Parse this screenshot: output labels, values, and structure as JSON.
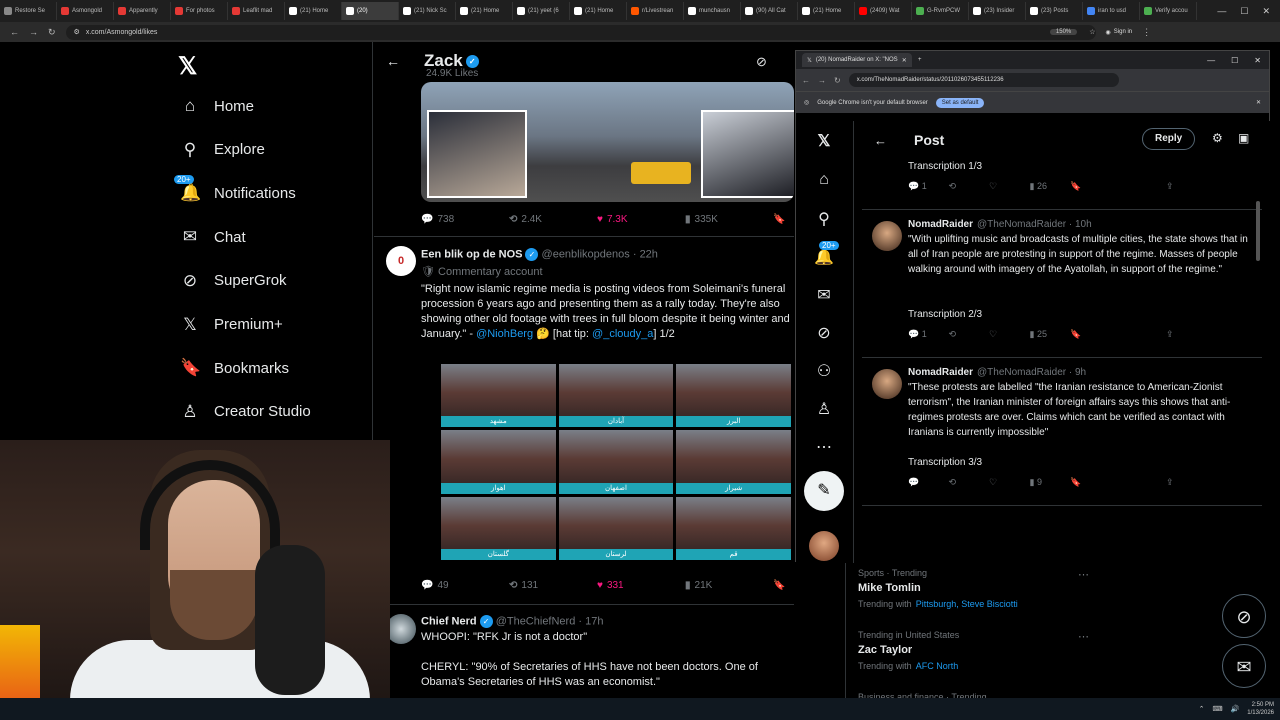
{
  "browser": {
    "tabs": [
      {
        "title": "Restore Se",
        "color": "#888888"
      },
      {
        "title": "Asmongold",
        "color": "#e53935"
      },
      {
        "title": "Apparently",
        "color": "#e53935"
      },
      {
        "title": "For photos",
        "color": "#e53935"
      },
      {
        "title": "Leaflit mad",
        "color": "#e53935"
      },
      {
        "title": "(21) Home",
        "color": "#ffffff"
      },
      {
        "title": "(20)",
        "color": "#ffffff"
      },
      {
        "title": "(21) Nick Sc",
        "color": "#ffffff"
      },
      {
        "title": "(21) Home",
        "color": "#ffffff"
      },
      {
        "title": "(21) yeet (6",
        "color": "#ffffff"
      },
      {
        "title": "(21) Home",
        "color": "#ffffff"
      },
      {
        "title": "r/Livestrean",
        "color": "#ff5700"
      },
      {
        "title": "munchausn",
        "color": "#ffffff"
      },
      {
        "title": "(90) All Cat",
        "color": "#ffffff"
      },
      {
        "title": "(21) Home",
        "color": "#ffffff"
      },
      {
        "title": "(2409) Wat",
        "color": "#ff0000"
      },
      {
        "title": "G-RvmPCW",
        "color": "#4caf50"
      },
      {
        "title": "(23) Insider",
        "color": "#ffffff"
      },
      {
        "title": "(23) Posts",
        "color": "#ffffff"
      },
      {
        "title": "iran to usd",
        "color": "#4285f4"
      },
      {
        "title": "Verify accou",
        "color": "#4caf50"
      }
    ],
    "active_tab_index": 6,
    "url": "x.com/Asmongold/likes",
    "zoom": "150%",
    "signin": "Sign in"
  },
  "leftnav": {
    "items": [
      {
        "label": "Home",
        "icon": "home-icon",
        "glyph": "⌂"
      },
      {
        "label": "Explore",
        "icon": "search-icon",
        "glyph": "⚲"
      },
      {
        "label": "Notifications",
        "icon": "bell-icon",
        "glyph": "🔔",
        "badge": "20+"
      },
      {
        "label": "Chat",
        "icon": "mail-icon",
        "glyph": "✉"
      },
      {
        "label": "SuperGrok",
        "icon": "grok-icon",
        "glyph": "⊘"
      },
      {
        "label": "Premium+",
        "icon": "x-icon",
        "glyph": "𝕏"
      },
      {
        "label": "Bookmarks",
        "icon": "bookmark-icon",
        "glyph": "🔖"
      },
      {
        "label": "Creator Studio",
        "icon": "creator-icon",
        "glyph": "♙"
      }
    ]
  },
  "main": {
    "header_name": "Zack",
    "header_likes": "24.9K Likes",
    "tweet1_actions": {
      "replies": "738",
      "reposts": "2.4K",
      "likes": "7.3K",
      "views": "335K"
    },
    "tweet2": {
      "name": "Een blik op de NOS",
      "handle": "@eenblikopdenos",
      "time": "22h",
      "subtitle": "Commentary account",
      "text_a": "\"Right now islamic regime media is posting videos from Soleimani's funeral procession 6 years ago and presenting them as a rally today. They're also showing other old footage  with trees in full bloom despite it being winter and January.\" - ",
      "mention": "@NiohBerg",
      "text_b": " 🤔 [hat tip: ",
      "mention2": "@_cloudy_a",
      "text_c": "] 1/2",
      "grid_labels": [
        "مشهد",
        "آبادان",
        "البرز",
        "اهواز",
        "اصفهان",
        "شیراز",
        "گلستان",
        "لرستان",
        "قم"
      ],
      "actions": {
        "replies": "49",
        "reposts": "131",
        "likes": "331",
        "views": "21K"
      }
    },
    "tweet3": {
      "name": "Chief Nerd",
      "handle": "@TheChiefNerd",
      "time": "17h",
      "line1": "WHOOPI: \"RFK Jr is not a doctor\"",
      "line2": "CHERYL: \"90% of Secretaries of HHS have not been doctors. One of Obama's Secretaries of HHS was an economist.\""
    }
  },
  "win2": {
    "tab_title": "(20) NomadRaider on X: \"NOS",
    "url": "x.com/TheNomadRaider/status/2011026073455112236",
    "info_text": "Google Chrome isn't your default browser",
    "set_default": "Set as default",
    "post_title": "Post",
    "reply_label": "Reply",
    "nav_badge": "20+",
    "items": [
      {
        "kind": "label",
        "text": "Transcription 1/3",
        "replies": "1",
        "views": "26"
      },
      {
        "name": "NomadRaider",
        "handle": "@TheNomadRaider",
        "time": "10h",
        "text": "\"With uplifting music and broadcasts of multiple cities, the state shows that in all of Iran people are protesting in support of the regime. Masses of people walking around with imagery of the Ayatollah, in support of the regime.\"",
        "label": "Transcription 2/3",
        "replies": "1",
        "views": "25"
      },
      {
        "name": "NomadRaider",
        "handle": "@TheNomadRaider",
        "time": "9h",
        "text": "\"These protests are labelled \"the Iranian resistance to American-Zionist terrorism\", the Iranian minister of foreign affairs says this shows that anti-regimes protests are over. Claims which cant be verified as contact with Iranians is currently impossible\"",
        "label": "Transcription 3/3",
        "replies": "",
        "views": "9"
      }
    ]
  },
  "trending": [
    {
      "sub": "Sports · Trending",
      "name": "Mike Tomlin",
      "with": "Trending with",
      "links": "Pittsburgh, Steve Bisciotti"
    },
    {
      "sub": "Trending in United States",
      "name": "Zac Taylor",
      "with": "Trending with",
      "links": "AFC North"
    },
    {
      "sub": "Business and finance · Trending",
      "name": "",
      "with": "",
      "links": ""
    }
  ],
  "taskbar": {
    "time": "2:50 PM",
    "date": "1/13/2026"
  },
  "colors": {
    "accent": "#1d9bf0",
    "like": "#f91880",
    "bg": "#000000",
    "border": "#2f3336"
  }
}
